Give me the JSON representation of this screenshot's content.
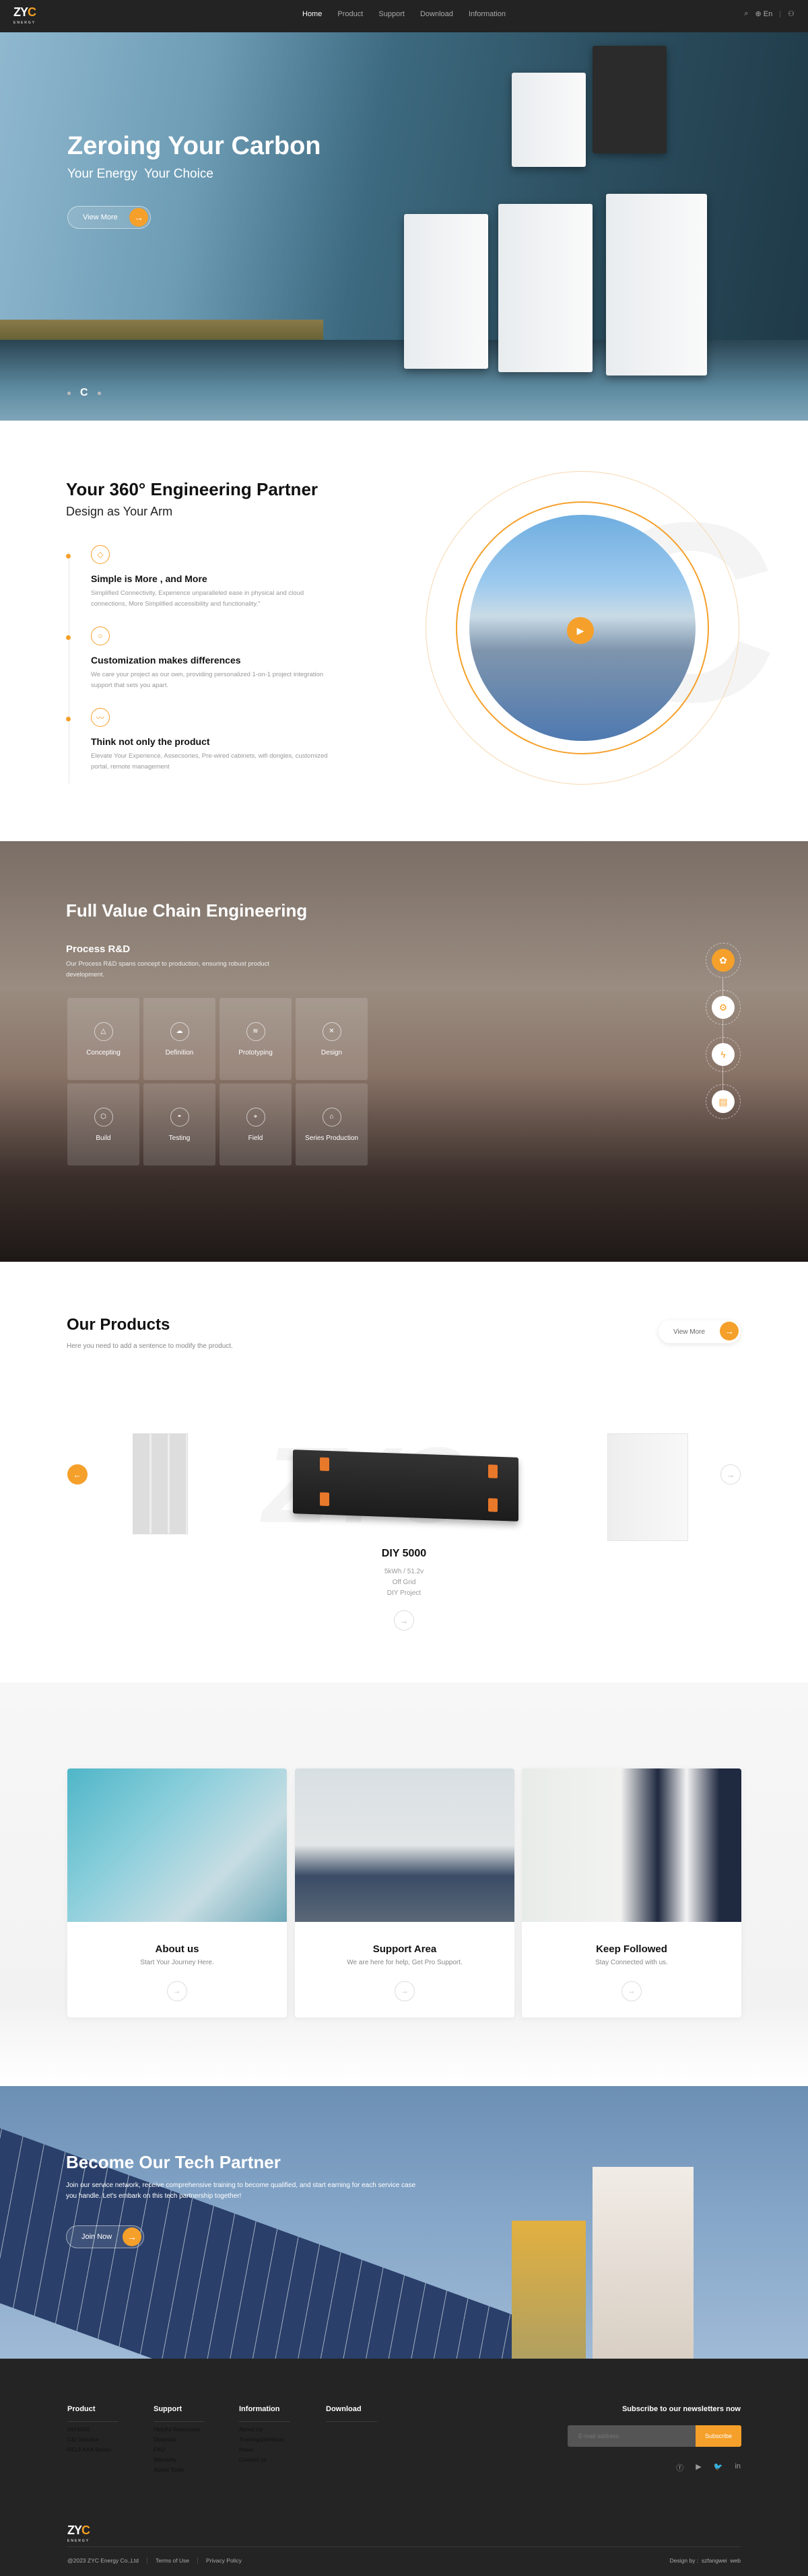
{
  "brand": {
    "name": "ZYC",
    "tag": "ENERGY",
    "accent": "#f5a02a"
  },
  "nav": {
    "items": [
      "Home",
      "Product",
      "Support",
      "Download",
      "Information"
    ],
    "active": "Home",
    "lang": "En",
    "icons": [
      "search-icon",
      "globe-icon",
      "user-icon"
    ]
  },
  "hero": {
    "title": "Zeroing Your Carbon",
    "subtitle": "Your Energy  Your Choice",
    "button": "View More"
  },
  "partner": {
    "title": "Your 360° Engineering Partner",
    "subtitle": "Design as Your Arm",
    "features": [
      {
        "title": "Simple is More , and More",
        "text": "Simplified Connectivity, Experience unparalleled ease in physical and cloud connections, More Simplified accessibility and functionality.\""
      },
      {
        "title": "Customization makes differences",
        "text": "We care your project as our own, providing personalized 1-on-1 project integration support that sets you apart."
      },
      {
        "title": "Think not only the product",
        "text": "Elevate Your Experience, Assecsories, Pre-wired cabinets, wifi dongles, customized portal, remote management"
      }
    ]
  },
  "chain": {
    "title": "Full Value Chain Engineering",
    "sub": "Process R&D",
    "text": "Our Process R&D spans concept to production, ensuring robust product development.",
    "steps": [
      "Concepting",
      "Definition",
      "Prototyping",
      "Design",
      "Build",
      "Testing",
      "Field",
      "Series Production"
    ]
  },
  "products": {
    "title": "Our Products",
    "subtitle": "Here you need to add a sentence to modify the product.",
    "view_more": "View More",
    "current": {
      "name": "DIY 5000",
      "specs": [
        "5kWh / 51.2v",
        "Off Grid",
        "DIY Project"
      ]
    }
  },
  "cards": [
    {
      "title": "About us",
      "text": "Start Your Journey Here."
    },
    {
      "title": "Support Area",
      "text": "We are here for help, Get Pro Support."
    },
    {
      "title": "Keep Followed",
      "text": "Stay Connected with us."
    }
  ],
  "tech": {
    "title": "Become Our Tech Partner",
    "text": "Join our service network, receive comprehensive training to become qualified, and start earning for each service case you handle. Let's embark on this tech partnership together!",
    "button": "Join Now"
  },
  "footer": {
    "cols": [
      {
        "title": "Product",
        "links": [
          "DIY5000",
          "C&I Solution",
          "RELEAXA Series"
        ]
      },
      {
        "title": "Support",
        "links": [
          "Helpful Resources",
          "Dowload",
          "FAQ",
          "Warranty",
          "Assist Tools"
        ]
      },
      {
        "title": "Information",
        "links": [
          "About Us",
          "Training&Webinar",
          "News",
          "Contact us"
        ]
      },
      {
        "title": "Download",
        "links": []
      }
    ],
    "subscribe_title": "Subscribe to our newsletters now",
    "email_placeholder": "E-mail address",
    "subscribe_button": "Subscribe",
    "social": [
      "facebook-icon",
      "youtube-icon",
      "twitter-icon",
      "linkedin-icon"
    ],
    "copyright": "@2023 ZYC Energy Co.,Ltd",
    "terms": "Terms of Use",
    "privacy": "Privacy Policy",
    "design": "Design by :  szfangwei  web"
  }
}
